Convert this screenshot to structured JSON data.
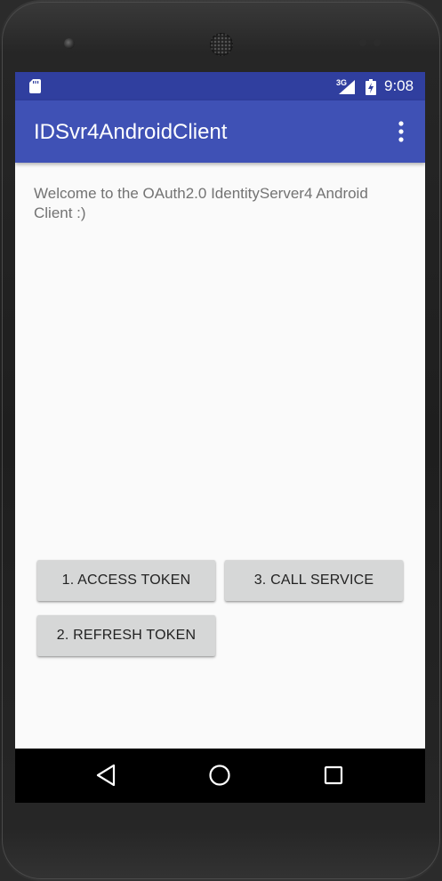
{
  "status_bar": {
    "network": "3G",
    "time": "9:08",
    "icons": [
      "sd-card-icon",
      "signal-icon",
      "battery-charging-icon"
    ]
  },
  "app_bar": {
    "title": "IDSvr4AndroidClient",
    "overflow_icon": "more-vert-icon"
  },
  "content": {
    "welcome_text": "Welcome to the OAuth2.0 IdentityServer4 Android Client :)"
  },
  "buttons": {
    "access_token": "1. ACCESS TOKEN",
    "call_service": "3. CALL SERVICE",
    "refresh_token": "2. REFRESH TOKEN"
  },
  "nav_bar": {
    "icons": [
      "back-icon",
      "home-icon",
      "recents-icon"
    ]
  },
  "colors": {
    "status_bar": "#303f9f",
    "app_bar": "#3f51b5",
    "background": "#fafafa",
    "button": "#d6d7d7"
  }
}
